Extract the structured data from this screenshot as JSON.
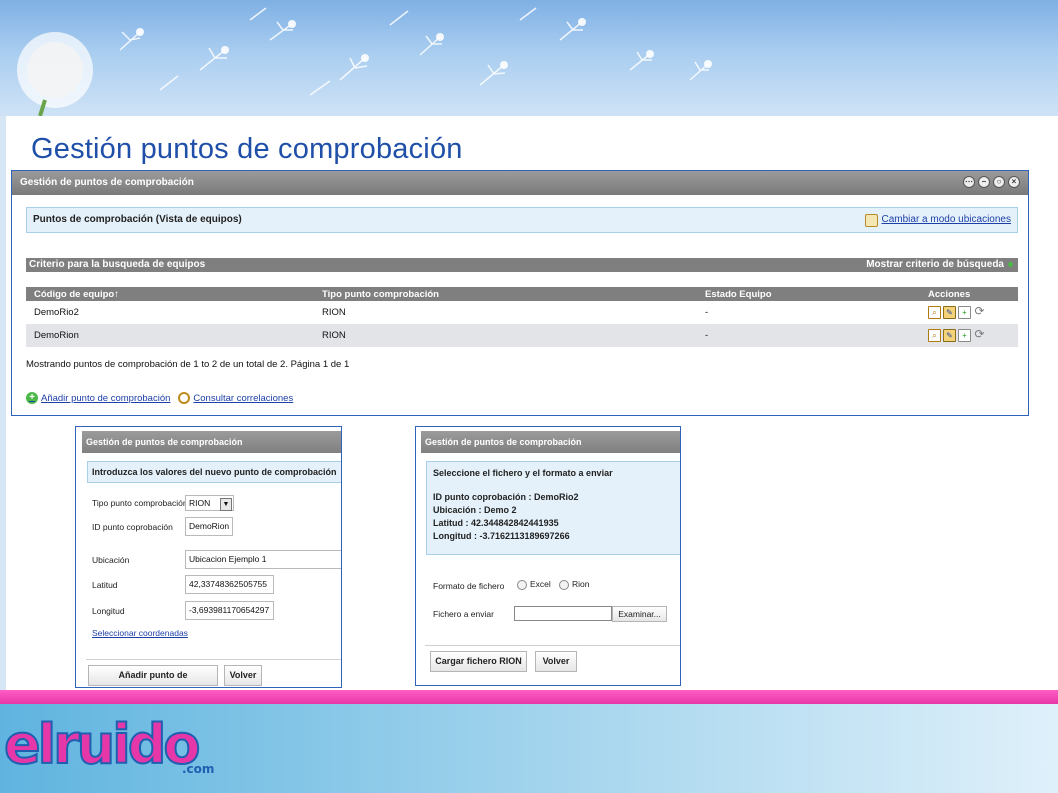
{
  "slide_title": "Gestión puntos de comprobación",
  "main_panel": {
    "header": "Gestión de puntos de comprobación",
    "view_title": "Puntos de comprobación (Vista de equipos)",
    "switch_link": "Cambiar a modo ubicaciones",
    "criteria_title": "Criterio para la busqueda de equipos",
    "criteria_toggle": "Mostrar criterio de búsqueda",
    "columns": [
      "Código de equipo↑",
      "Tipo punto comprobación",
      "Estado Equipo",
      "Acciones"
    ],
    "rows": [
      {
        "codigo": "DemoRio2",
        "tipo": "RION",
        "estado": "-"
      },
      {
        "codigo": "DemoRion",
        "tipo": "RION",
        "estado": "-"
      }
    ],
    "summary": "Mostrando puntos de comprobación de 1 to 2 de un total de 2. Página 1 de 1",
    "add_link": "Añadir punto de comprobación",
    "query_link": "Consultar correlaciones"
  },
  "add_panel": {
    "header": "Gestión de puntos de comprobación",
    "intro": "Introduzca los valores del nuevo punto de comprobación",
    "tipo_label": "Tipo punto comprobación",
    "tipo_value": "RION",
    "id_label": "ID punto coprobación",
    "id_value": "DemoRion",
    "ubicacion_label": "Ubicación",
    "ubicacion_value": "Ubicacion Ejemplo 1",
    "latitud_label": "Latitud",
    "latitud_value": "42,33748362505755",
    "longitud_label": "Longitud",
    "longitud_value": "-3,693981170654297",
    "coords_link": "Seleccionar coordenadas",
    "submit_button": "Añadir punto de comprobación",
    "back_button": "Volver"
  },
  "upload_panel": {
    "header": "Gestión de puntos de comprobación",
    "intro": "Seleccione el fichero y el formato a enviar",
    "id_line": "ID punto coprobación : DemoRio2",
    "ubicacion_line": "Ubicación : Demo 2",
    "latitud_line": "Latitud : 42.344842842441935",
    "longitud_line": "Longitud : -3.7162113189697266",
    "format_label": "Formato de fichero",
    "format_options": [
      "Excel",
      "Rion"
    ],
    "file_label": "Fichero a enviar",
    "browse_button": "Examinar...",
    "upload_button": "Cargar fichero RION",
    "back_button": "Volver"
  },
  "footer": {
    "logo_main": "elruido",
    "logo_suffix": ".com"
  },
  "colors": {
    "title_blue": "#1f4fa8",
    "panel_border": "#2f62b8",
    "pink": "#e637a8"
  }
}
